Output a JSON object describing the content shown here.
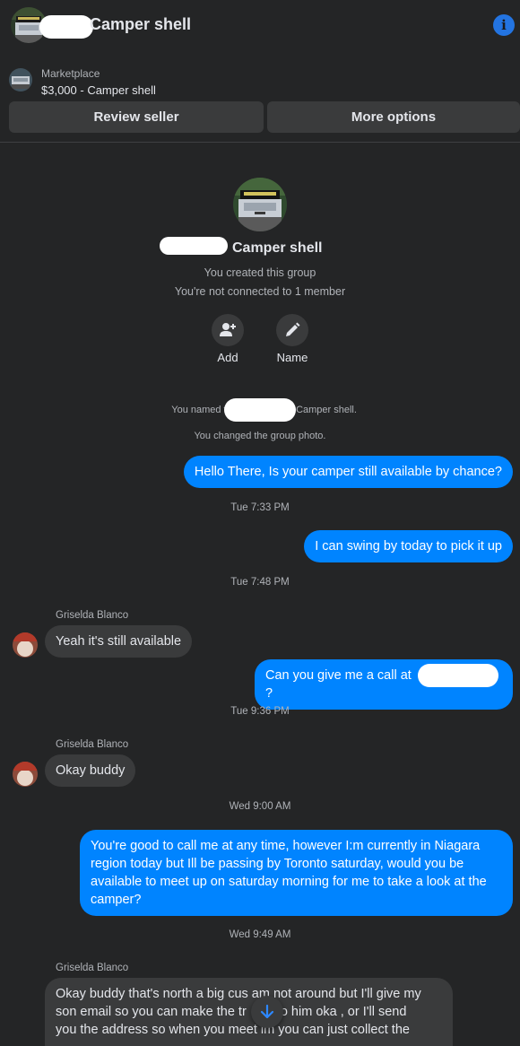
{
  "header": {
    "title": "Camper shell",
    "info_icon": "info-icon"
  },
  "marketplace": {
    "label": "Marketplace",
    "item": "$3,000 - Camper shell"
  },
  "buttons": {
    "review_seller": "Review seller",
    "more_options": "More options"
  },
  "group": {
    "name": "Camper shell",
    "created": "You created this group",
    "connection": "You're not connected to 1 member",
    "add_label": "Add",
    "name_label": "Name"
  },
  "system": {
    "named_prefix": "You named th",
    "named_suffix": "Camper shell.",
    "changed_photo": "You changed the group photo."
  },
  "messages": [
    {
      "from": "me",
      "text": "Hello There, Is your camper still available by chance?"
    },
    {
      "time": "Tue 7:33 PM"
    },
    {
      "from": "me",
      "text": "I can swing by today to pick it up"
    },
    {
      "time": "Tue 7:48 PM"
    },
    {
      "sender": "Griselda Blanco",
      "text": "Yeah it's still available"
    },
    {
      "from": "me",
      "text_prefix": "Can you give me a call at ",
      "text_suffix": "?"
    },
    {
      "time": "Tue 9:36 PM"
    },
    {
      "sender": "Griselda Blanco",
      "text": "Okay buddy"
    },
    {
      "time": "Wed 9:00 AM"
    },
    {
      "from": "me",
      "text": "You're good to call me at any time, however I:m currently in Niagara region today but Ill be passing by Toronto saturday, would you be available to meet up on saturday morning for me to take a look at the camper?"
    },
    {
      "time": "Wed 9:49 AM"
    },
    {
      "sender": "Griselda Blanco",
      "line1": "Okay buddy that's north a big cus am not around but I'll give my",
      "line2a": "son email so you can make the tr",
      "line2b": " to him oka , or I'll send",
      "line3a": "you the address so when you meet ",
      "line3b": "im you can just collect the"
    }
  ],
  "colors": {
    "accent": "#0084ff",
    "background": "#242526",
    "bubble_in": "#3a3b3c"
  }
}
